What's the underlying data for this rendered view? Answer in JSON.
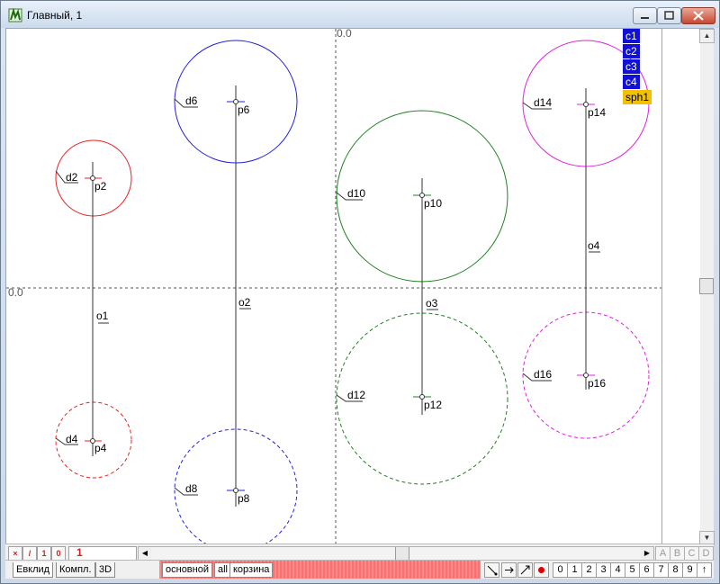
{
  "window": {
    "title": "Главный, 1"
  },
  "canvas": {
    "axis_top_label": "0.0",
    "axis_left_label": "0.0",
    "points": [
      "p2",
      "p4",
      "p6",
      "p8",
      "p10",
      "p12",
      "p14",
      "p16"
    ],
    "axes": [
      "o1",
      "o2",
      "o3",
      "o4"
    ],
    "circles": [
      "d2",
      "d4",
      "d6",
      "d8",
      "d10",
      "d12",
      "d14",
      "d16"
    ],
    "colors": {
      "red": "#e82020",
      "blue": "#2020e0",
      "green": "#208020",
      "magenta": "#e020e0"
    }
  },
  "legend": {
    "items": [
      "c1",
      "c2",
      "c3",
      "c4"
    ],
    "sphere": "sph1"
  },
  "statusbar": {
    "mini_buttons": [
      "×",
      "/",
      "1",
      "0"
    ],
    "page_number": "1",
    "letters": [
      "A",
      "B",
      "C",
      "D"
    ]
  },
  "tabs": {
    "left": [
      "Евклид",
      "Компл.",
      "3D"
    ],
    "pages": [
      "основной",
      "all",
      "корзина"
    ]
  },
  "toolbar": {
    "numbers": [
      "0",
      "1",
      "2",
      "3",
      "4",
      "5",
      "6",
      "7",
      "8",
      "9",
      "↑"
    ]
  }
}
